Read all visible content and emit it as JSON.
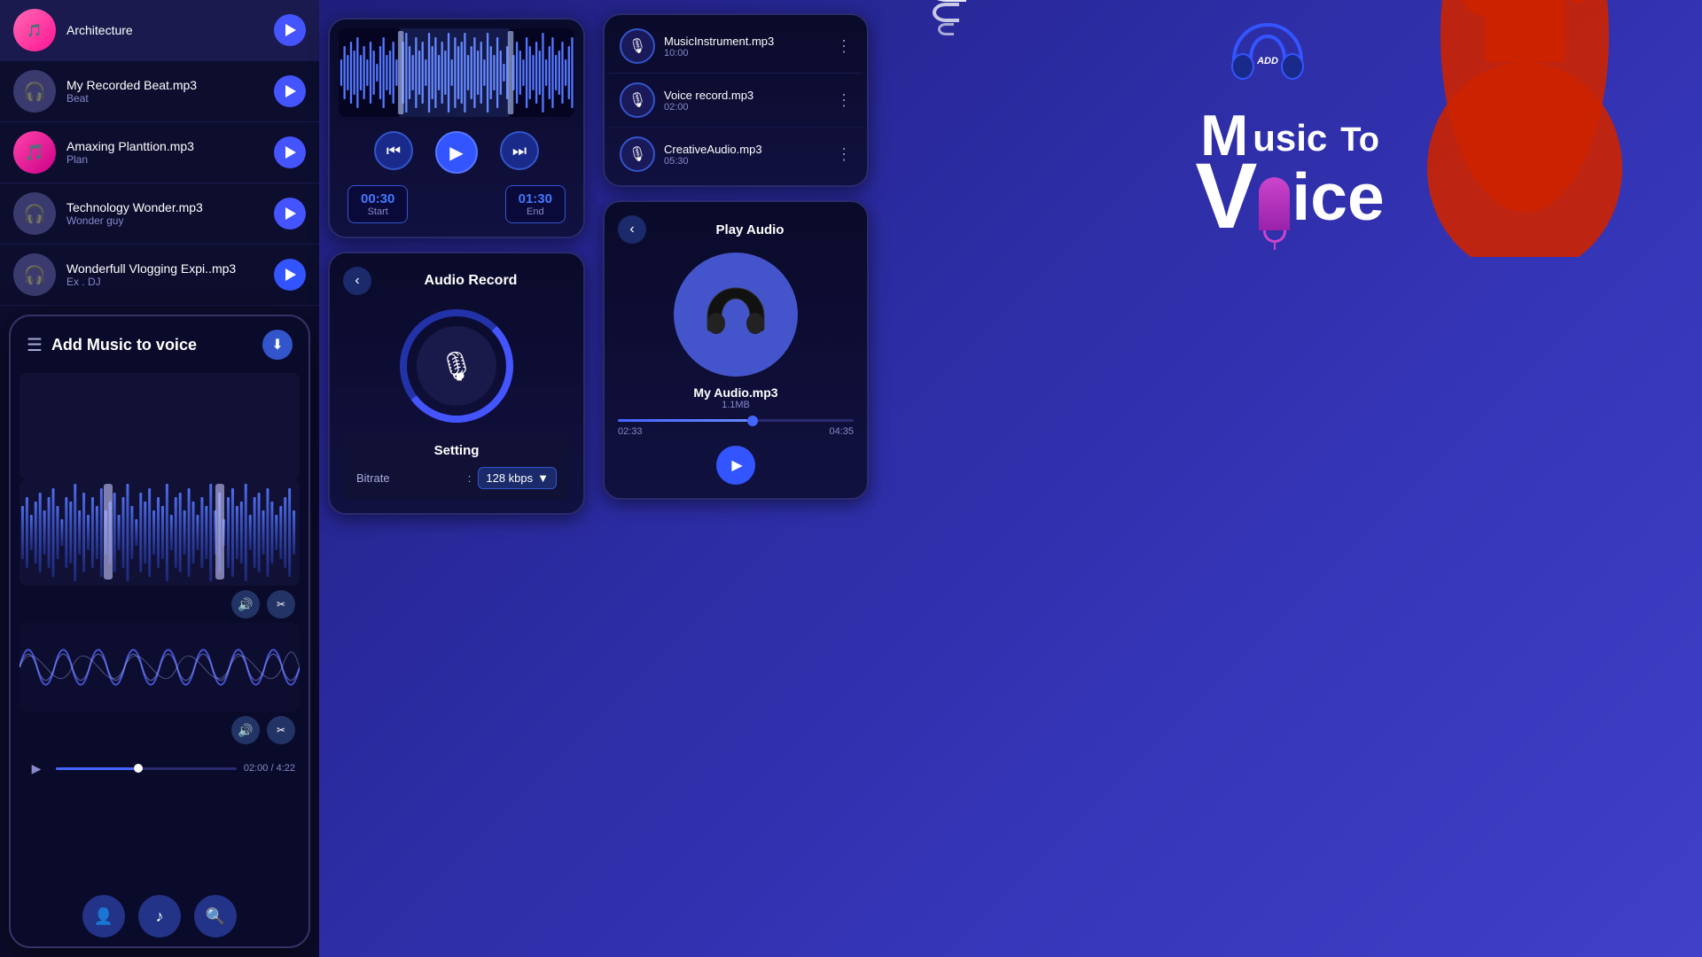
{
  "panel1": {
    "tracks": [
      {
        "name": "Architecture",
        "artist": "",
        "thumb_type": "pink",
        "thumb_icon": "🎵"
      },
      {
        "name": "My Recorded Beat.mp3",
        "artist": "Beat",
        "thumb_type": "dark",
        "thumb_icon": "🎧"
      },
      {
        "name": "Amaxing Planttion.mp3",
        "artist": "Plan",
        "thumb_type": "pink",
        "thumb_icon": "🎵"
      },
      {
        "name": "Technology Wonder.mp3",
        "artist": "Wonder guy",
        "thumb_type": "dark",
        "thumb_icon": "🎧"
      },
      {
        "name": "Wonderfull Vlogging Expi..mp3",
        "artist": "Ex . DJ",
        "thumb_type": "dark",
        "thumb_icon": "🎧"
      }
    ]
  },
  "panel2": {
    "title": "Add Music to voice",
    "progress_time": "02:00 / 4:22",
    "bottom_buttons": [
      "👤",
      "🎵",
      "🔍"
    ]
  },
  "trim_panel": {
    "start_time": "00:30",
    "start_label": "Start",
    "end_time": "01:30",
    "end_label": "End"
  },
  "record_panel": {
    "title": "Audio Record",
    "back_label": "‹",
    "setting_title": "Setting",
    "bitrate_label": "Bitrate",
    "bitrate_colon": ":",
    "bitrate_value": "128 kbps"
  },
  "music_list_panel": {
    "tracks": [
      {
        "name": "MusicInstrument.mp3",
        "time": "10:00"
      },
      {
        "name": "Voice record.mp3",
        "time": "02:00"
      },
      {
        "name": "CreativeAudio.mp3",
        "time": "05:30"
      }
    ]
  },
  "play_audio_panel": {
    "title": "Play Audio",
    "audio_name": "My Audio.mp3",
    "audio_size": "1.1MB",
    "time_current": "02:33",
    "time_total": "04:35"
  },
  "brand": {
    "add_text": "ADD",
    "music_text": "Music",
    "to_text": "To",
    "v_text": "V",
    "ice_text": "ice"
  }
}
